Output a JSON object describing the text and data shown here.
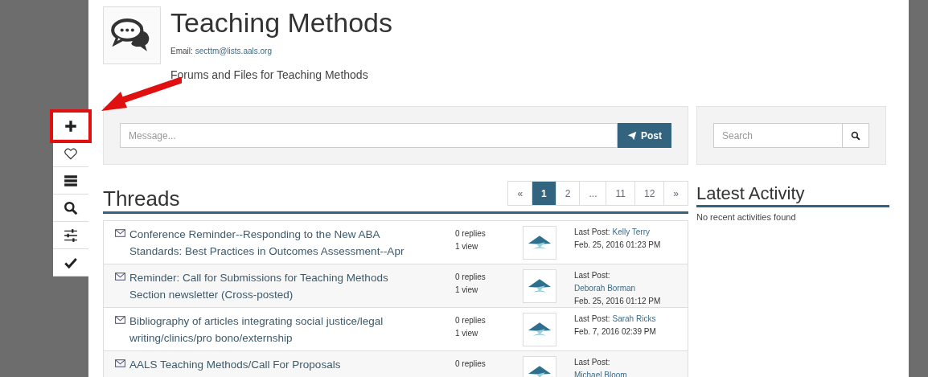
{
  "header": {
    "title": "Teaching Methods",
    "email_label": "Email:",
    "email": "secttm@lists.aals.org",
    "subtitle": "Forums and Files for Teaching Methods"
  },
  "toolbar": [
    {
      "kind": "plus",
      "highlighted": true
    },
    {
      "kind": "heart",
      "highlighted": false
    },
    {
      "kind": "list",
      "highlighted": false
    },
    {
      "kind": "search",
      "highlighted": false
    },
    {
      "kind": "sliders",
      "highlighted": false
    },
    {
      "kind": "check",
      "highlighted": false
    }
  ],
  "composer": {
    "placeholder": "Message...",
    "button": "Post"
  },
  "search": {
    "placeholder": "Search"
  },
  "threads": {
    "title": "Threads",
    "pagination": [
      {
        "label": "«",
        "selected": false
      },
      {
        "label": "1",
        "selected": true
      },
      {
        "label": "2",
        "selected": false
      },
      {
        "label": "...",
        "selected": false
      },
      {
        "label": "11",
        "selected": false
      },
      {
        "label": "12",
        "selected": false
      },
      {
        "label": "»",
        "selected": false
      }
    ],
    "rows": [
      {
        "title": "Conference Reminder--Responding to the New ABA Standards: Best Practices in Outcomes Assessment--Apr",
        "replies": "0 replies",
        "views": "1 view",
        "last_post_label": "Last Post:",
        "author": "Kelly Terry",
        "date": "Feb. 25, 2016 01:23 PM"
      },
      {
        "title": "Reminder: Call for Submissions for Teaching Methods Section newsletter (Cross-posted)",
        "replies": "0 replies",
        "views": "1 view",
        "last_post_label": "Last Post:",
        "author": "Deborah Borman",
        "date": "Feb. 25, 2016 01:12 PM"
      },
      {
        "title": "Bibliography of articles integrating social justice/legal writing/clinics/pro bono/externship",
        "replies": "0 replies",
        "views": "1 view",
        "last_post_label": "Last Post:",
        "author": "Sarah Ricks",
        "date": "Feb. 7, 2016 02:39 PM"
      },
      {
        "title": "AALS Teaching Methods/Call For Proposals",
        "replies": "0 replies",
        "last_post_label": "Last Post:",
        "author": "Michael Bloom"
      }
    ]
  },
  "activity": {
    "title": "Latest Activity",
    "empty": "No recent activities found"
  }
}
